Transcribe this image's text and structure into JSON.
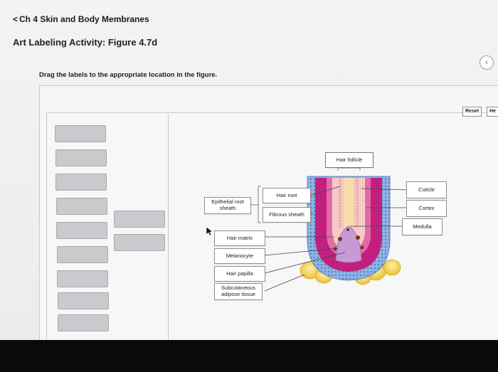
{
  "header": {
    "back_chevron": "<",
    "chapter_link": "Ch 4 Skin and Body Membranes",
    "activity_title": "Art Labeling Activity: Figure 4.7d"
  },
  "instruction": "Drag the labels to the appropriate location in the figure.",
  "toolbar": {
    "reset_label": "Reset",
    "help_label": "He"
  },
  "nav": {
    "circle_icon": "chevron-left-icon",
    "circle_glyph": "‹"
  },
  "figure_labels": {
    "hair_follicle": "Hair follicle",
    "hair_root": "Hair root",
    "epithelial_root_sheath": "Epithelial root sheath",
    "fibrous_sheath": "Fibrous sheath",
    "cuticle": "Cuticle",
    "cortex": "Cortex",
    "medulla": "Medulla",
    "hair_matrix": "Hair matrix",
    "melanocyte": "Melanocyte",
    "hair_papilla": "Hair papilla",
    "subcutaneous_adipose_tissue": "Subcutaneous adipose tissue"
  },
  "colors": {
    "slot_fill": "#c9cacd",
    "outer_sheath": "#7aa3d8",
    "follicle_wall": "#c2207e",
    "hair_core": "#f3c6c2",
    "papilla": "#c79ad6",
    "fat": "#f2d14d"
  }
}
